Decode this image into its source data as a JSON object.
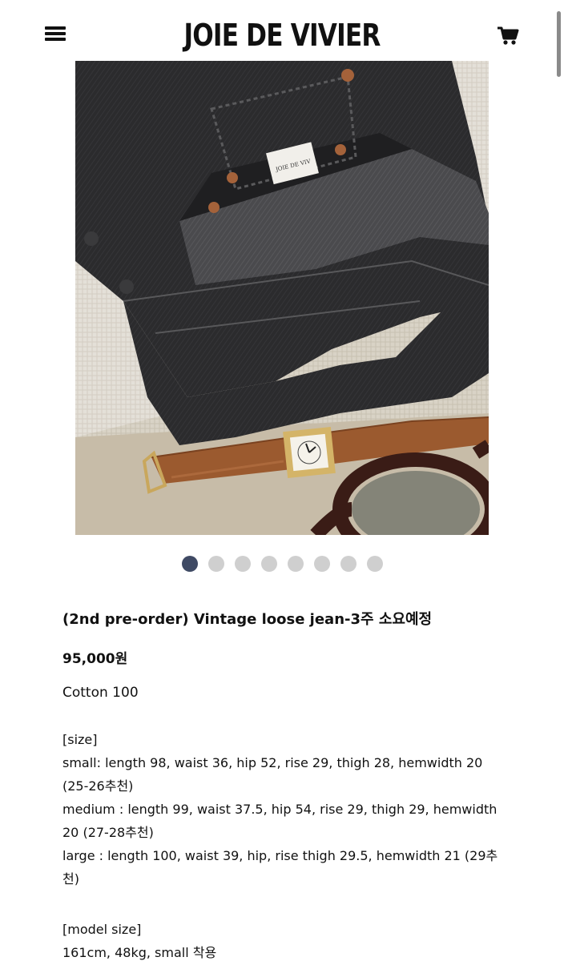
{
  "header": {
    "brand": "JOIE DE VIVIER",
    "menu_icon": "hamburger-menu-icon",
    "cart_icon": "shopping-cart-icon"
  },
  "gallery": {
    "image_alt": "Black vintage loose jeans laid on linen with a brown leather watch and tortoise glasses",
    "slides_count": 8,
    "active_slide": 1
  },
  "product": {
    "title": "(2nd pre-order) Vintage loose jean-3주 소요예정",
    "price": "95,000원",
    "material": "Cotton 100",
    "size_heading": "[size]",
    "sizes": [
      "small: length 98, waist 36, hip 52, rise 29, thigh 28, hemwidth 20 (25-26추천)",
      "medium : length 99, waist 37.5, hip 54, rise 29, thigh 29, hemwidth 20 (27-28추천)",
      "large : length 100, waist 39, hip, rise thigh 29.5, hemwidth 21 (29추천)"
    ],
    "model_heading": "[model size]",
    "model_info": "161cm, 48kg, small 착용"
  },
  "colors": {
    "active_dot": "#3f4a64",
    "inactive_dot": "#cfcfcf"
  }
}
